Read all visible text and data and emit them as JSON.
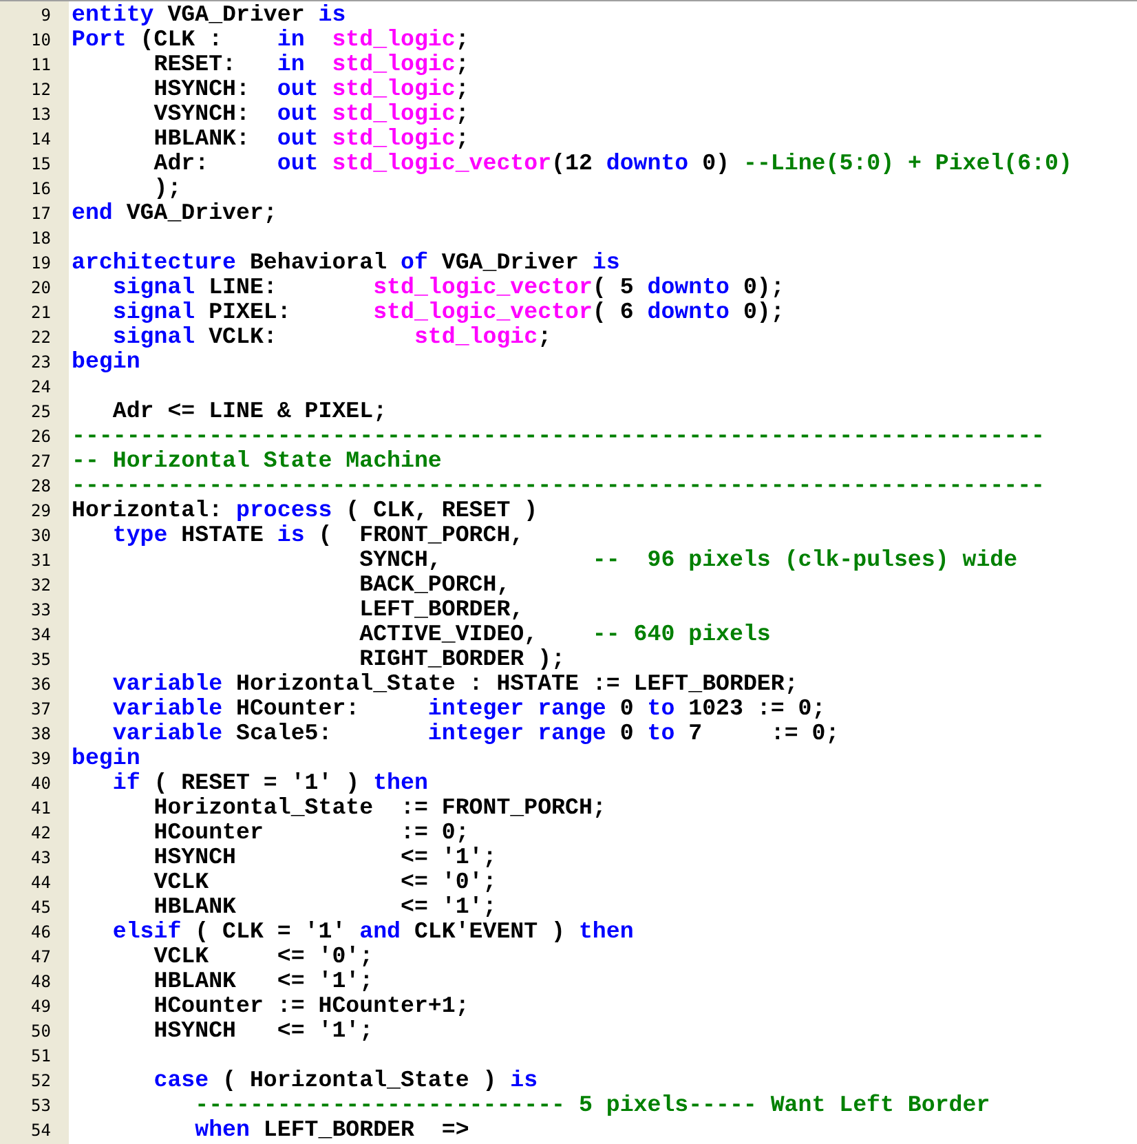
{
  "editor": {
    "lines": [
      {
        "number": "9",
        "tokens": [
          {
            "kind": "keyword",
            "text": "entity"
          },
          {
            "kind": "plain",
            "text": " VGA_Driver "
          },
          {
            "kind": "keyword",
            "text": "is"
          }
        ]
      },
      {
        "number": "10",
        "tokens": [
          {
            "kind": "keyword",
            "text": "Port"
          },
          {
            "kind": "plain",
            "text": " (CLK :    "
          },
          {
            "kind": "keyword",
            "text": "in"
          },
          {
            "kind": "type",
            "text": "  std_logic"
          },
          {
            "kind": "plain",
            "text": ";"
          }
        ]
      },
      {
        "number": "11",
        "tokens": [
          {
            "kind": "plain",
            "text": "      RESET:   "
          },
          {
            "kind": "keyword",
            "text": "in"
          },
          {
            "kind": "type",
            "text": "  std_logic"
          },
          {
            "kind": "plain",
            "text": ";"
          }
        ]
      },
      {
        "number": "12",
        "tokens": [
          {
            "kind": "plain",
            "text": "      HSYNCH:  "
          },
          {
            "kind": "keyword",
            "text": "out"
          },
          {
            "kind": "type",
            "text": " std_logic"
          },
          {
            "kind": "plain",
            "text": ";"
          }
        ]
      },
      {
        "number": "13",
        "tokens": [
          {
            "kind": "plain",
            "text": "      VSYNCH:  "
          },
          {
            "kind": "keyword",
            "text": "out"
          },
          {
            "kind": "type",
            "text": " std_logic"
          },
          {
            "kind": "plain",
            "text": ";"
          }
        ]
      },
      {
        "number": "14",
        "tokens": [
          {
            "kind": "plain",
            "text": "      HBLANK:  "
          },
          {
            "kind": "keyword",
            "text": "out"
          },
          {
            "kind": "type",
            "text": " std_logic"
          },
          {
            "kind": "plain",
            "text": ";"
          }
        ]
      },
      {
        "number": "15",
        "tokens": [
          {
            "kind": "plain",
            "text": "      Adr:     "
          },
          {
            "kind": "keyword",
            "text": "out"
          },
          {
            "kind": "type",
            "text": " std_logic_vector"
          },
          {
            "kind": "plain",
            "text": "(12 "
          },
          {
            "kind": "keyword",
            "text": "downto"
          },
          {
            "kind": "plain",
            "text": " 0) "
          },
          {
            "kind": "comment",
            "text": "--Line(5:0) + Pixel(6:0)"
          }
        ]
      },
      {
        "number": "16",
        "tokens": [
          {
            "kind": "plain",
            "text": "      );"
          }
        ]
      },
      {
        "number": "17",
        "tokens": [
          {
            "kind": "keyword",
            "text": "end"
          },
          {
            "kind": "plain",
            "text": " VGA_Driver;"
          }
        ]
      },
      {
        "number": "18"
      },
      {
        "number": "19",
        "tokens": [
          {
            "kind": "keyword",
            "text": "architecture"
          },
          {
            "kind": "plain",
            "text": " Behavioral "
          },
          {
            "kind": "keyword",
            "text": "of"
          },
          {
            "kind": "plain",
            "text": " VGA_Driver "
          },
          {
            "kind": "keyword",
            "text": "is"
          }
        ]
      },
      {
        "number": "20",
        "tokens": [
          {
            "kind": "keyword",
            "text": "   signal"
          },
          {
            "kind": "plain",
            "text": " LINE:       "
          },
          {
            "kind": "type",
            "text": "std_logic_vector"
          },
          {
            "kind": "plain",
            "text": "( 5 "
          },
          {
            "kind": "keyword",
            "text": "downto"
          },
          {
            "kind": "plain",
            "text": " 0);"
          }
        ]
      },
      {
        "number": "21",
        "tokens": [
          {
            "kind": "keyword",
            "text": "   signal"
          },
          {
            "kind": "plain",
            "text": " PIXEL:      "
          },
          {
            "kind": "type",
            "text": "std_logic_vector"
          },
          {
            "kind": "plain",
            "text": "( 6 "
          },
          {
            "kind": "keyword",
            "text": "downto"
          },
          {
            "kind": "plain",
            "text": " 0);"
          }
        ]
      },
      {
        "number": "22",
        "tokens": [
          {
            "kind": "keyword",
            "text": "   signal"
          },
          {
            "kind": "plain",
            "text": " VCLK:          "
          },
          {
            "kind": "type",
            "text": "std_logic"
          },
          {
            "kind": "plain",
            "text": ";"
          }
        ]
      },
      {
        "number": "23",
        "tokens": [
          {
            "kind": "keyword",
            "text": "begin"
          }
        ]
      },
      {
        "number": "24"
      },
      {
        "number": "25",
        "tokens": [
          {
            "kind": "plain",
            "text": "   Adr <= LINE & PIXEL;"
          }
        ]
      },
      {
        "number": "26",
        "tokens": [
          {
            "kind": "comment",
            "text": "-----------------------------------------------------------------------"
          }
        ]
      },
      {
        "number": "27",
        "tokens": [
          {
            "kind": "comment",
            "text": "-- Horizontal State Machine"
          }
        ]
      },
      {
        "number": "28",
        "tokens": [
          {
            "kind": "comment",
            "text": "-----------------------------------------------------------------------"
          }
        ]
      },
      {
        "number": "29",
        "tokens": [
          {
            "kind": "plain",
            "text": "Horizontal: "
          },
          {
            "kind": "keyword",
            "text": "process"
          },
          {
            "kind": "plain",
            "text": " ( CLK, RESET )"
          }
        ]
      },
      {
        "number": "30",
        "tokens": [
          {
            "kind": "keyword",
            "text": "   type"
          },
          {
            "kind": "plain",
            "text": " HSTATE "
          },
          {
            "kind": "keyword",
            "text": "is"
          },
          {
            "kind": "plain",
            "text": " (  FRONT_PORCH,"
          }
        ]
      },
      {
        "number": "31",
        "tokens": [
          {
            "kind": "plain",
            "text": "                     SYNCH,           "
          },
          {
            "kind": "comment",
            "text": "--  96 pixels (clk-pulses) wide"
          }
        ]
      },
      {
        "number": "32",
        "tokens": [
          {
            "kind": "plain",
            "text": "                     BACK_PORCH,"
          }
        ]
      },
      {
        "number": "33",
        "tokens": [
          {
            "kind": "plain",
            "text": "                     LEFT_BORDER,"
          }
        ]
      },
      {
        "number": "34",
        "tokens": [
          {
            "kind": "plain",
            "text": "                     ACTIVE_VIDEO,    "
          },
          {
            "kind": "comment",
            "text": "-- 640 pixels"
          }
        ]
      },
      {
        "number": "35",
        "tokens": [
          {
            "kind": "plain",
            "text": "                     RIGHT_BORDER );"
          }
        ]
      },
      {
        "number": "36",
        "tokens": [
          {
            "kind": "keyword",
            "text": "   variable"
          },
          {
            "kind": "plain",
            "text": " Horizontal_State : HSTATE := LEFT_BORDER;"
          }
        ]
      },
      {
        "number": "37",
        "tokens": [
          {
            "kind": "keyword",
            "text": "   variable"
          },
          {
            "kind": "plain",
            "text": " HCounter:     "
          },
          {
            "kind": "keyword",
            "text": "integer range"
          },
          {
            "kind": "plain",
            "text": " 0 "
          },
          {
            "kind": "keyword",
            "text": "to"
          },
          {
            "kind": "plain",
            "text": " 1023 := 0;"
          }
        ]
      },
      {
        "number": "38",
        "tokens": [
          {
            "kind": "keyword",
            "text": "   variable"
          },
          {
            "kind": "plain",
            "text": " Scale5:       "
          },
          {
            "kind": "keyword",
            "text": "integer range"
          },
          {
            "kind": "plain",
            "text": " 0 "
          },
          {
            "kind": "keyword",
            "text": "to"
          },
          {
            "kind": "plain",
            "text": " 7     := 0;"
          }
        ]
      },
      {
        "number": "39",
        "tokens": [
          {
            "kind": "keyword",
            "text": "begin"
          }
        ]
      },
      {
        "number": "40",
        "tokens": [
          {
            "kind": "keyword",
            "text": "   if"
          },
          {
            "kind": "plain",
            "text": " ( RESET = '1' ) "
          },
          {
            "kind": "keyword",
            "text": "then"
          }
        ]
      },
      {
        "number": "41",
        "tokens": [
          {
            "kind": "plain",
            "text": "      Horizontal_State  := FRONT_PORCH;"
          }
        ]
      },
      {
        "number": "42",
        "tokens": [
          {
            "kind": "plain",
            "text": "      HCounter          := 0;"
          }
        ]
      },
      {
        "number": "43",
        "tokens": [
          {
            "kind": "plain",
            "text": "      HSYNCH            <= '1';"
          }
        ]
      },
      {
        "number": "44",
        "tokens": [
          {
            "kind": "plain",
            "text": "      VCLK              <= '0';"
          }
        ]
      },
      {
        "number": "45",
        "tokens": [
          {
            "kind": "plain",
            "text": "      HBLANK            <= '1';"
          }
        ]
      },
      {
        "number": "46",
        "tokens": [
          {
            "kind": "keyword",
            "text": "   elsif"
          },
          {
            "kind": "plain",
            "text": " ( CLK = '1' "
          },
          {
            "kind": "keyword",
            "text": "and"
          },
          {
            "kind": "plain",
            "text": " CLK'EVENT ) "
          },
          {
            "kind": "keyword",
            "text": "then"
          }
        ]
      },
      {
        "number": "47",
        "tokens": [
          {
            "kind": "plain",
            "text": "      VCLK     <= '0';"
          }
        ]
      },
      {
        "number": "48",
        "tokens": [
          {
            "kind": "plain",
            "text": "      HBLANK   <= '1';"
          }
        ]
      },
      {
        "number": "49",
        "tokens": [
          {
            "kind": "plain",
            "text": "      HCounter := HCounter+1;"
          }
        ]
      },
      {
        "number": "50",
        "tokens": [
          {
            "kind": "plain",
            "text": "      HSYNCH   <= '1';"
          }
        ]
      },
      {
        "number": "51"
      },
      {
        "number": "52",
        "tokens": [
          {
            "kind": "keyword",
            "text": "      case"
          },
          {
            "kind": "plain",
            "text": " ( Horizontal_State ) "
          },
          {
            "kind": "keyword",
            "text": "is"
          }
        ]
      },
      {
        "number": "53",
        "tokens": [
          {
            "kind": "comment",
            "text": "         --------------------------- 5 pixels----- Want Left Border"
          }
        ]
      },
      {
        "number": "54",
        "tokens": [
          {
            "kind": "keyword",
            "text": "         when"
          },
          {
            "kind": "plain",
            "text": " LEFT_BORDER  =>"
          }
        ]
      }
    ]
  }
}
